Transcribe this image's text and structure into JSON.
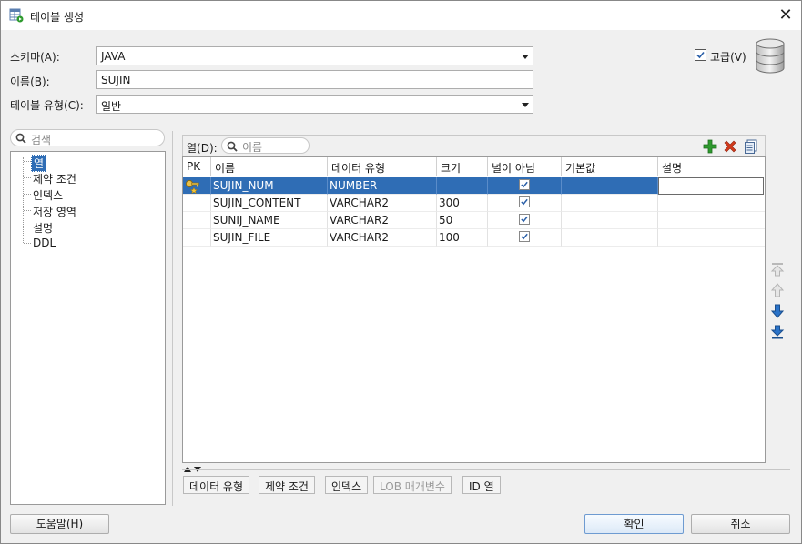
{
  "window": {
    "title": "테이블 생성",
    "close_glyph": "✕"
  },
  "form": {
    "schema_label": "스키마(A):",
    "schema_value": "JAVA",
    "name_label": "이름(B):",
    "name_value": "SUJIN",
    "type_label": "테이블 유형(C):",
    "type_value": "일반",
    "advanced_label": "고급(V)",
    "advanced_checked": true
  },
  "left_panel": {
    "search_placeholder": "검색",
    "tree_items": [
      "열",
      "제약 조건",
      "인덱스",
      "저장 영역",
      "설명",
      "DDL"
    ]
  },
  "columns_panel": {
    "label": "열(D):",
    "search_placeholder": "이름",
    "headers": [
      "PK",
      "이름",
      "데이터 유형",
      "크기",
      "널이 아님",
      "기본값",
      "설명"
    ],
    "rows": [
      {
        "pk": true,
        "name": "SUJIN_NUM",
        "type": "NUMBER",
        "size": "",
        "not_null": true,
        "default": "",
        "desc": ""
      },
      {
        "pk": false,
        "name": "SUJIN_CONTENT",
        "type": "VARCHAR2",
        "size": "300",
        "not_null": true,
        "default": "",
        "desc": ""
      },
      {
        "pk": false,
        "name": "SUNIJ_NAME",
        "type": "VARCHAR2",
        "size": "50",
        "not_null": true,
        "default": "",
        "desc": ""
      },
      {
        "pk": false,
        "name": "SUJIN_FILE",
        "type": "VARCHAR2",
        "size": "100",
        "not_null": true,
        "default": "",
        "desc": ""
      }
    ],
    "bottom_tabs": [
      {
        "label": "데이터 유형",
        "enabled": true
      },
      {
        "label": "제약 조건",
        "enabled": true
      },
      {
        "label": "인덱스",
        "enabled": true
      },
      {
        "label": "LOB 매개변수",
        "enabled": false
      },
      {
        "label": "ID 열",
        "enabled": true
      }
    ]
  },
  "buttons": {
    "help": "도움말(H)",
    "ok": "확인",
    "cancel": "취소"
  },
  "colors": {
    "selection": "#2f6db5",
    "add_icon": "#2e9a2e",
    "delete_icon": "#d23a1c",
    "arrow_icon": "#2a73c9"
  }
}
